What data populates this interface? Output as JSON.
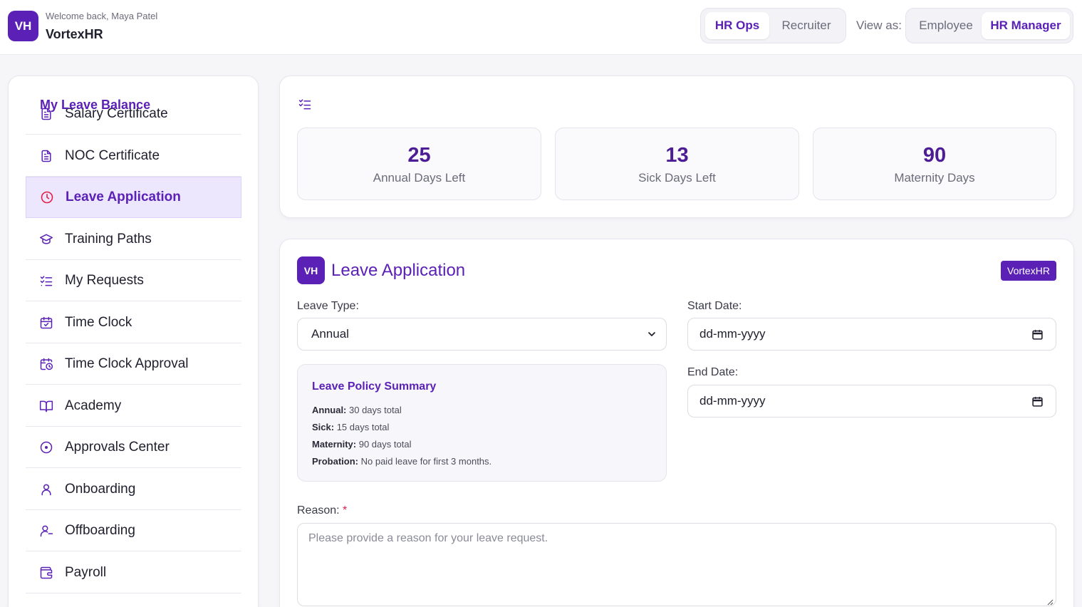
{
  "header": {
    "logo_text": "VH",
    "welcome": "Welcome back, Maya Patel",
    "brand": "VortexHR",
    "workspace_tabs": [
      {
        "label": "HR Ops",
        "active": true
      },
      {
        "label": "Recruiter",
        "active": false
      }
    ],
    "view_as_label": "View as:",
    "view_as_options": [
      {
        "label": "Employee",
        "active": false
      },
      {
        "label": "HR Manager",
        "active": true
      }
    ]
  },
  "sidebar": {
    "items": [
      {
        "label": "Salary Certificate",
        "icon": "document-icon"
      },
      {
        "label": "NOC Certificate",
        "icon": "document-icon"
      },
      {
        "label": "Leave Application",
        "icon": "clock-icon",
        "active": true
      },
      {
        "label": "Training Paths",
        "icon": "graduation-cap-icon"
      },
      {
        "label": "My Requests",
        "icon": "checklist-icon"
      },
      {
        "label": "Time Clock",
        "icon": "calendar-check-icon"
      },
      {
        "label": "Time Clock Approval",
        "icon": "calendar-clock-icon"
      },
      {
        "label": "Academy",
        "icon": "book-icon"
      },
      {
        "label": "Approvals Center",
        "icon": "circle-dot-icon"
      },
      {
        "label": "Onboarding",
        "icon": "user-icon"
      },
      {
        "label": "Offboarding",
        "icon": "user-minus-icon"
      },
      {
        "label": "Payroll",
        "icon": "wallet-icon"
      }
    ]
  },
  "balance": {
    "title": "My Leave Balance",
    "stats": [
      {
        "value": "25",
        "label": "Annual Days Left"
      },
      {
        "value": "13",
        "label": "Sick Days Left"
      },
      {
        "value": "90",
        "label": "Maternity Days"
      }
    ]
  },
  "application": {
    "logo_text": "VH",
    "title": "Leave Application",
    "badge": "VortexHR",
    "leave_type_label": "Leave Type:",
    "leave_type_value": "Annual",
    "start_date_label": "Start Date:",
    "start_date_value": "dd-mm-yyyy",
    "end_date_label": "End Date:",
    "end_date_value": "dd-mm-yyyy",
    "policy": {
      "title": "Leave Policy Summary",
      "rows": [
        {
          "key": "Annual:",
          "value": " 30 days total"
        },
        {
          "key": "Sick:",
          "value": " 15 days total"
        },
        {
          "key": "Maternity:",
          "value": " 90 days total"
        },
        {
          "key": "Probation:",
          "value": " No paid leave for first 3 months."
        }
      ]
    },
    "reason_label": "Reason:",
    "reason_required_mark": "*",
    "reason_placeholder": "Please provide a reason for your leave request."
  },
  "colors": {
    "accent": "#5b21b6",
    "accent_light": "#ede7fe",
    "leave_icon": "#e11d48"
  }
}
